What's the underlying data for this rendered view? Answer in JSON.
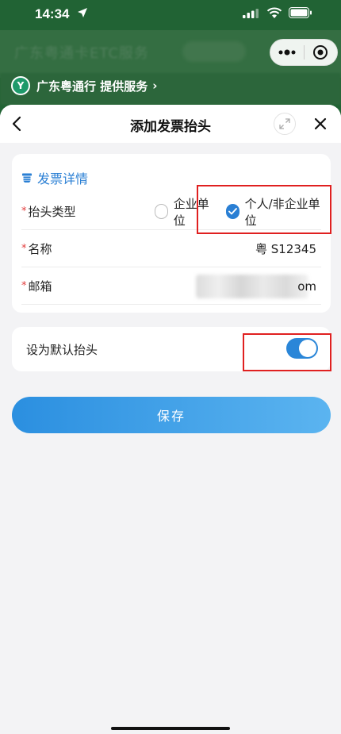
{
  "status_bar": {
    "time": "14:34"
  },
  "backdrop": {
    "title": "广东粤通卡ETC服务"
  },
  "provider": {
    "logo_text": "Y",
    "text": "广东粤通行 提供服务",
    "chevron": "›"
  },
  "nav": {
    "title": "添加发票抬头"
  },
  "details": {
    "section_title": "发票详情",
    "header_type": {
      "required_mark": "*",
      "label": "抬头类型",
      "options": [
        "企业单位",
        "个人/非企业单位"
      ],
      "selected": "个人/非企业单位"
    },
    "name": {
      "required_mark": "*",
      "label": "名称",
      "value": "粤 S12345"
    },
    "email": {
      "required_mark": "*",
      "label": "邮箱",
      "value_suffix": "om"
    }
  },
  "default_header": {
    "label": "设为默认抬头",
    "enabled": true
  },
  "save_button": {
    "label": "保存"
  },
  "colors": {
    "accent": "#2a7fd4",
    "required": "#e23c3c",
    "highlight": "#e02020",
    "backdrop": "#2f8a48"
  },
  "icons": [
    "location-arrow-icon",
    "signal-icon",
    "wifi-icon",
    "battery-icon",
    "more-dots-icon",
    "target-close-icon",
    "back-chevron-icon",
    "expand-icon",
    "close-icon",
    "invoice-icon",
    "checkmark-icon"
  ]
}
